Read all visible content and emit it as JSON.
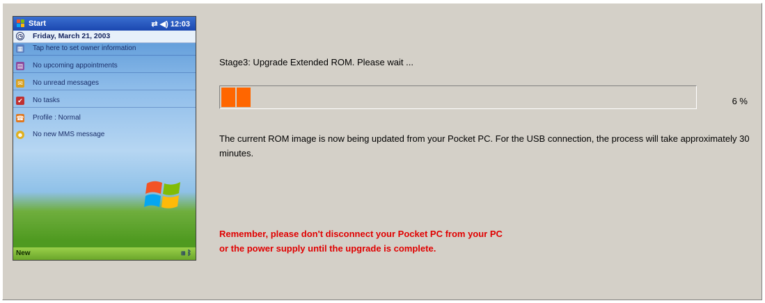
{
  "pocket_pc": {
    "title": "Start",
    "time": "12:03",
    "date": "Friday, March 21, 2003",
    "items": [
      {
        "label": "Tap here to set owner information",
        "icon": "owner-icon"
      },
      {
        "label": "No upcoming appointments",
        "icon": "calendar-icon"
      },
      {
        "label": "No unread messages",
        "icon": "inbox-icon"
      },
      {
        "label": "No tasks",
        "icon": "tasks-icon"
      },
      {
        "label": "Profile : Normal",
        "icon": "phone-icon"
      },
      {
        "label": "No new MMS message",
        "icon": "mms-icon"
      }
    ],
    "softkey_left": "New"
  },
  "upgrade": {
    "stage_text": "Stage3: Upgrade Extended ROM. Please wait ...",
    "progress_percent": 6,
    "percent_label": "6  %",
    "description": "The current ROM image is now being updated from your Pocket PC. For the USB connection, the process will take approximately 30 minutes.",
    "warning_line1": "Remember, please don't disconnect your Pocket PC from your PC",
    "warning_line2": "or the power supply until the upgrade is complete."
  },
  "colors": {
    "progress_fill": "#ff6600",
    "warning_text": "#e00000",
    "window_bg": "#d4d0c8"
  }
}
